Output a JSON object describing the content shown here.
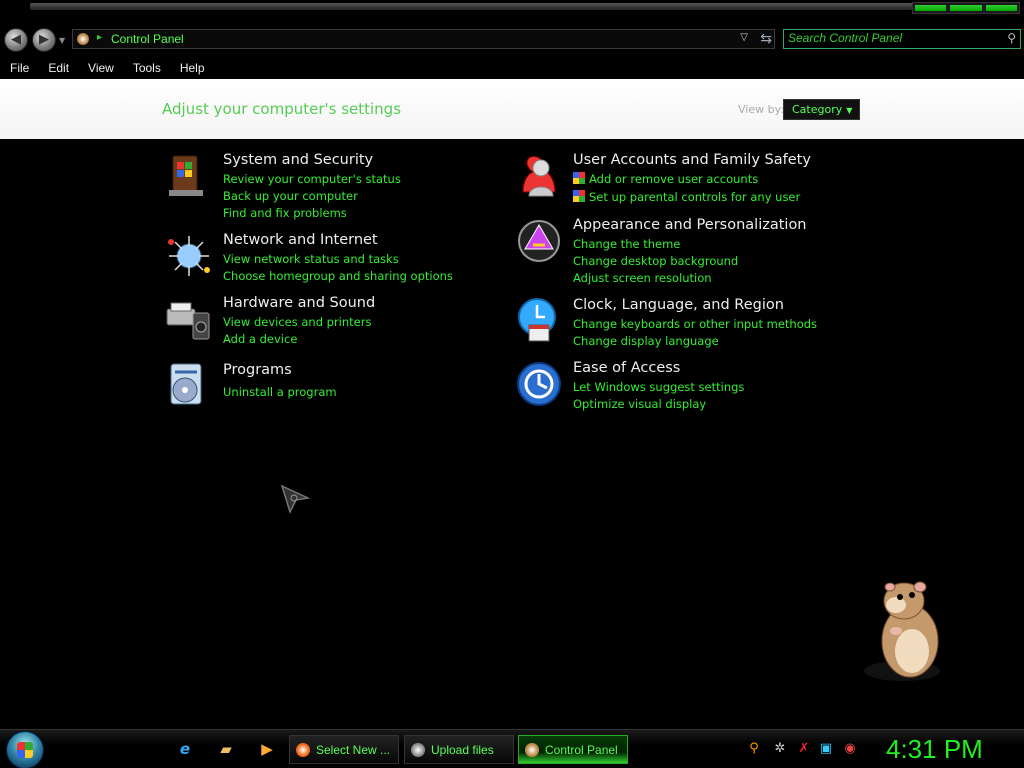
{
  "address_bar": {
    "path": "Control Panel"
  },
  "search": {
    "placeholder": "Search Control Panel"
  },
  "menu": [
    "File",
    "Edit",
    "View",
    "Tools",
    "Help"
  ],
  "header": {
    "title": "Adjust your computer's settings",
    "view_by_label": "View by:",
    "view_by_value": "Category"
  },
  "categories": [
    {
      "title": "System and Security",
      "icon": "system-security-icon",
      "links": [
        "Review your computer's status",
        "Back up your computer",
        "Find and fix problems"
      ]
    },
    {
      "title": "Network and Internet",
      "icon": "network-internet-icon",
      "links": [
        "View network status and tasks",
        "Choose homegroup and sharing options"
      ]
    },
    {
      "title": "Hardware and Sound",
      "icon": "hardware-sound-icon",
      "links": [
        "View devices and printers",
        "Add a device"
      ]
    },
    {
      "title": "Programs",
      "icon": "programs-icon",
      "links": [
        "Uninstall a program"
      ]
    },
    {
      "title": "User Accounts and Family Safety",
      "icon": "user-accounts-icon",
      "links": [
        "Add or remove user accounts",
        "Set up parental controls for any user"
      ]
    },
    {
      "title": "Appearance and Personalization",
      "icon": "appearance-icon",
      "links": [
        "Change the theme",
        "Change desktop background",
        "Adjust screen resolution"
      ]
    },
    {
      "title": "Clock, Language, and Region",
      "icon": "clock-region-icon",
      "links": [
        "Change keyboards or other input methods",
        "Change display language"
      ]
    },
    {
      "title": "Ease of Access",
      "icon": "ease-of-access-icon",
      "links": [
        "Let Windows suggest settings",
        "Optimize visual display"
      ]
    }
  ],
  "taskbar": {
    "tasks": [
      "Select New ...",
      "Upload files",
      "Control Panel"
    ],
    "clock": "4:31 PM"
  },
  "colors": {
    "accent_green": "#33ee33",
    "background": "#000000",
    "banner": "#ffffff"
  }
}
